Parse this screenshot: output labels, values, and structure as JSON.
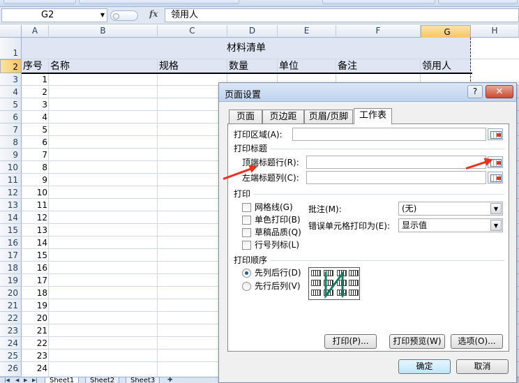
{
  "formula_bar": {
    "name_box": "G2",
    "fx": "fx",
    "value": "领用人"
  },
  "columns": [
    "A",
    "B",
    "C",
    "D",
    "E",
    "F",
    "G",
    "H"
  ],
  "selected_column": "G",
  "row_numbers": [
    "1",
    "2",
    "3",
    "4",
    "5",
    "6",
    "7",
    "8",
    "9",
    "10",
    "11",
    "12",
    "13",
    "14",
    "15",
    "16",
    "17",
    "18",
    "19",
    "20",
    "21",
    "22",
    "23",
    "24",
    "25",
    "26"
  ],
  "sheet": {
    "title": "材料清单",
    "headers": {
      "a": "序号",
      "b": "名称",
      "c": "规格",
      "d": "数量",
      "e": "单位",
      "f": "备注",
      "g": "领用人"
    },
    "serials": [
      "1",
      "2",
      "3",
      "4",
      "5",
      "6",
      "7",
      "8",
      "9",
      "10",
      "11",
      "12",
      "13",
      "14",
      "15",
      "16",
      "17",
      "18",
      "19",
      "20",
      "21",
      "22",
      "23",
      "24"
    ]
  },
  "sheet_tabs": [
    "Sheet1",
    "Sheet2",
    "Sheet3"
  ],
  "dialog": {
    "title": "页面设置",
    "help": "?",
    "close": "✕",
    "tabs": [
      "页面",
      "页边距",
      "页眉/页脚",
      "工作表"
    ],
    "active_tab": "工作表",
    "print_area_label": "打印区域(A):",
    "print_titles_group": "打印标题",
    "rows_to_repeat_label": "顶端标题行(R):",
    "cols_to_repeat_label": "左端标题列(C):",
    "print_group": "打印",
    "checkboxes": [
      "网格线(G)",
      "单色打印(B)",
      "草稿品质(Q)",
      "行号列标(L)"
    ],
    "comments_label": "批注(M):",
    "comments_value": "(无)",
    "cell_errors_label": "错误单元格打印为(E):",
    "cell_errors_value": "显示值",
    "page_order_group": "打印顺序",
    "radios": [
      "先列后行(D)",
      "先行后列(V)"
    ],
    "buttons": {
      "print": "打印(P)...",
      "preview": "打印预览(W)",
      "options": "选项(O)...",
      "ok": "确定",
      "cancel": "取消"
    }
  },
  "colors": {
    "arrow": "#e8321e",
    "selected_header": "#f6c45f",
    "title_fill": "#dfe5f3"
  }
}
